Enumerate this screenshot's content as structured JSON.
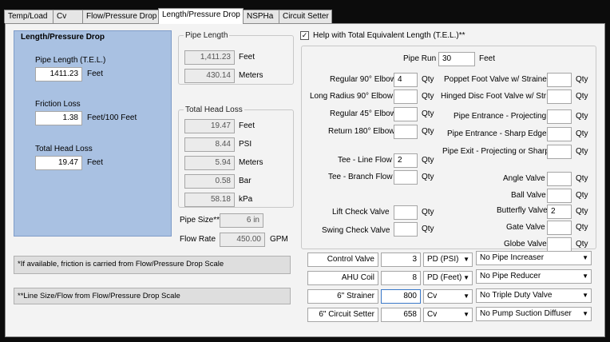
{
  "tabs": [
    {
      "label": "Temp/Load"
    },
    {
      "label": "Cv"
    },
    {
      "label": "Flow/Pressure Drop"
    },
    {
      "label": "Length/Pressure Drop"
    },
    {
      "label": "NSPHa"
    },
    {
      "label": "Circuit Setter"
    }
  ],
  "left_panel": {
    "title": "Length/Pressure Drop",
    "pipe_length_label": "Pipe Length (T.E.L.)",
    "pipe_length_value": "1411.23",
    "pipe_length_unit": "Feet",
    "friction_label": "Friction Loss",
    "friction_value": "1.38",
    "friction_unit": "Feet/100 Feet",
    "head_loss_label": "Total Head Loss",
    "head_loss_value": "19.47",
    "head_loss_unit": "Feet"
  },
  "pipe_length_group": {
    "title": "Pipe Length",
    "feet_value": "1,411.23",
    "feet_unit": "Feet",
    "meters_value": "430.14",
    "meters_unit": "Meters"
  },
  "head_loss_group": {
    "title": "Total Head Loss",
    "rows": [
      {
        "value": "19.47",
        "unit": "Feet"
      },
      {
        "value": "8.44",
        "unit": "PSI"
      },
      {
        "value": "5.94",
        "unit": "Meters"
      },
      {
        "value": "0.58",
        "unit": "Bar"
      },
      {
        "value": "58.18",
        "unit": "kPa"
      }
    ]
  },
  "pipe_size": {
    "label": "Pipe Size**",
    "value": "6 in"
  },
  "flow_rate": {
    "label": "Flow Rate",
    "value": "450.00",
    "unit": "GPM"
  },
  "notes": {
    "note1": "*If available, friction is carried from Flow/Pressure Drop Scale",
    "note2": "**Line Size/Flow from Flow/Pressure Drop Scale"
  },
  "tel_help": {
    "checked": true,
    "label": "Help with Total Equivalent Length (T.E.L.)**",
    "pipe_run_label": "Pipe Run",
    "pipe_run_value": "30",
    "pipe_run_unit": "Feet",
    "qty_label": "Qty",
    "left_fittings": [
      {
        "label": "Regular 90° Elbow",
        "qty": "4"
      },
      {
        "label": "Long Radius 90° Elbow",
        "qty": ""
      },
      {
        "label": "Regular 45° Elbow",
        "qty": ""
      },
      {
        "label": "Return 180° Elbow",
        "qty": ""
      },
      {
        "label": "Tee - Line Flow",
        "qty": "2"
      },
      {
        "label": "Tee - Branch Flow",
        "qty": ""
      },
      {
        "label": "Lift Check Valve",
        "qty": ""
      },
      {
        "label": "Swing Check Valve",
        "qty": ""
      }
    ],
    "right_fittings": [
      {
        "label": "Poppet Foot Valve w/ Strainer",
        "qty": ""
      },
      {
        "label": "Hinged Disc Foot Valve w/ Str",
        "qty": ""
      },
      {
        "label": "Pipe Entrance - Projecting",
        "qty": ""
      },
      {
        "label": "Pipe Entrance - Sharp Edge",
        "qty": ""
      },
      {
        "label": "Pipe Exit - Projecting or Sharp",
        "qty": ""
      },
      {
        "label": "Angle Valve",
        "qty": ""
      },
      {
        "label": "Ball Valve",
        "qty": ""
      },
      {
        "label": "Butterfly Valve",
        "qty": "2"
      },
      {
        "label": "Gate Valve",
        "qty": ""
      },
      {
        "label": "Globe Valve",
        "qty": ""
      }
    ],
    "components": [
      {
        "name": "Control Valve",
        "value": "3",
        "unit": "PD (PSI)",
        "option": "No Pipe Increaser"
      },
      {
        "name": "AHU Coil",
        "value": "8",
        "unit": "PD (Feet)",
        "option": "No Pipe Reducer"
      },
      {
        "name": "6\" Strainer",
        "value": "800",
        "unit": "Cv",
        "option": "No Triple Duty Valve"
      },
      {
        "name": "6\" Circuit Setter",
        "value": "658",
        "unit": "Cv",
        "option": "No Pump Suction Diffuser"
      }
    ]
  },
  "colors": {
    "left_panel_bg": "#a9c1e2",
    "page_bg": "#f3f3f3"
  }
}
